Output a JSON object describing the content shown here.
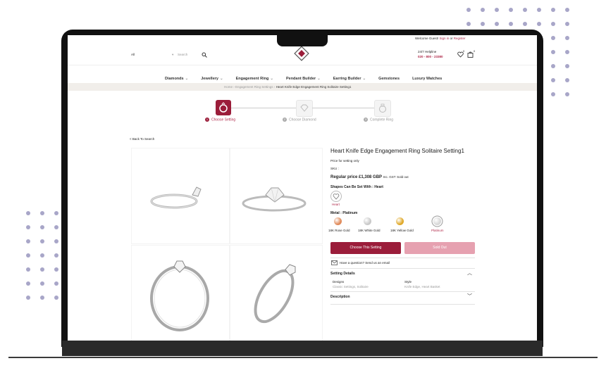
{
  "header": {
    "welcome": "Welcome Guest!",
    "sign_in": "Sign in",
    "or": "or",
    "register": "Register",
    "search_category": "All",
    "search_placeholder": "Search",
    "helpline_label": "24/7 Helpline",
    "helpline_number": "020 - 800 - 23380",
    "wishlist_count": "0",
    "cart_count": "0"
  },
  "nav": {
    "items": [
      "Diamonds",
      "Jewellery",
      "Engagement Ring",
      "Pendant Builder",
      "Earring Builder",
      "Gemstones",
      "Luxury Watches"
    ],
    "dropdown_flags": [
      true,
      true,
      true,
      true,
      true,
      false,
      false
    ]
  },
  "breadcrumb": {
    "home": "Home",
    "section": "Engagement Ring Settings",
    "current": "Heart Knife Edge Engagement Ring Solitaire Setting1"
  },
  "steps": [
    {
      "num": "1",
      "label": "Choose Setting"
    },
    {
      "num": "2",
      "label": "Choose Diamond"
    },
    {
      "num": "3",
      "label": "Complete Ring"
    }
  ],
  "back_link": "< Back To Search",
  "product": {
    "title": "Heart Knife Edge Engagement Ring Solitaire Setting1",
    "price_note": "Price for setting only",
    "sku_label": "SKU :",
    "regular_price_label": "Regular price",
    "price": "£1,308 GBP",
    "tax_note": "Inc. GST",
    "sold_out_tag": "Sold out",
    "shapes_label": "Shapes Can Be Set With : Heart",
    "shape_name": "Heart",
    "metal_label": "Metal : Platinum",
    "metals": [
      {
        "name": "18K Rose Gold",
        "color": "#e08a5a",
        "selected": false
      },
      {
        "name": "18K White Gold",
        "color": "#c9c9c9",
        "selected": false
      },
      {
        "name": "18K Yellow Gold",
        "color": "#e0a92a",
        "selected": false
      },
      {
        "name": "Platinum",
        "color": "#d8d8d8",
        "selected": true
      }
    ],
    "choose_button": "Choose This Setting",
    "soldout_button": "Sold Out",
    "question": "Have a question? Send us an email",
    "details_heading": "Setting Details",
    "designs_label": "Designs",
    "designs_value": "Classic Settings, Solitaire",
    "style_label": "Style",
    "style_value": "Knife Edge, Heart Basket",
    "description_heading": "Description"
  },
  "colors": {
    "accent": "#9b1d3a",
    "accent_light": "#e6a1b0",
    "breadcrumb_bg": "#f1eeea"
  }
}
